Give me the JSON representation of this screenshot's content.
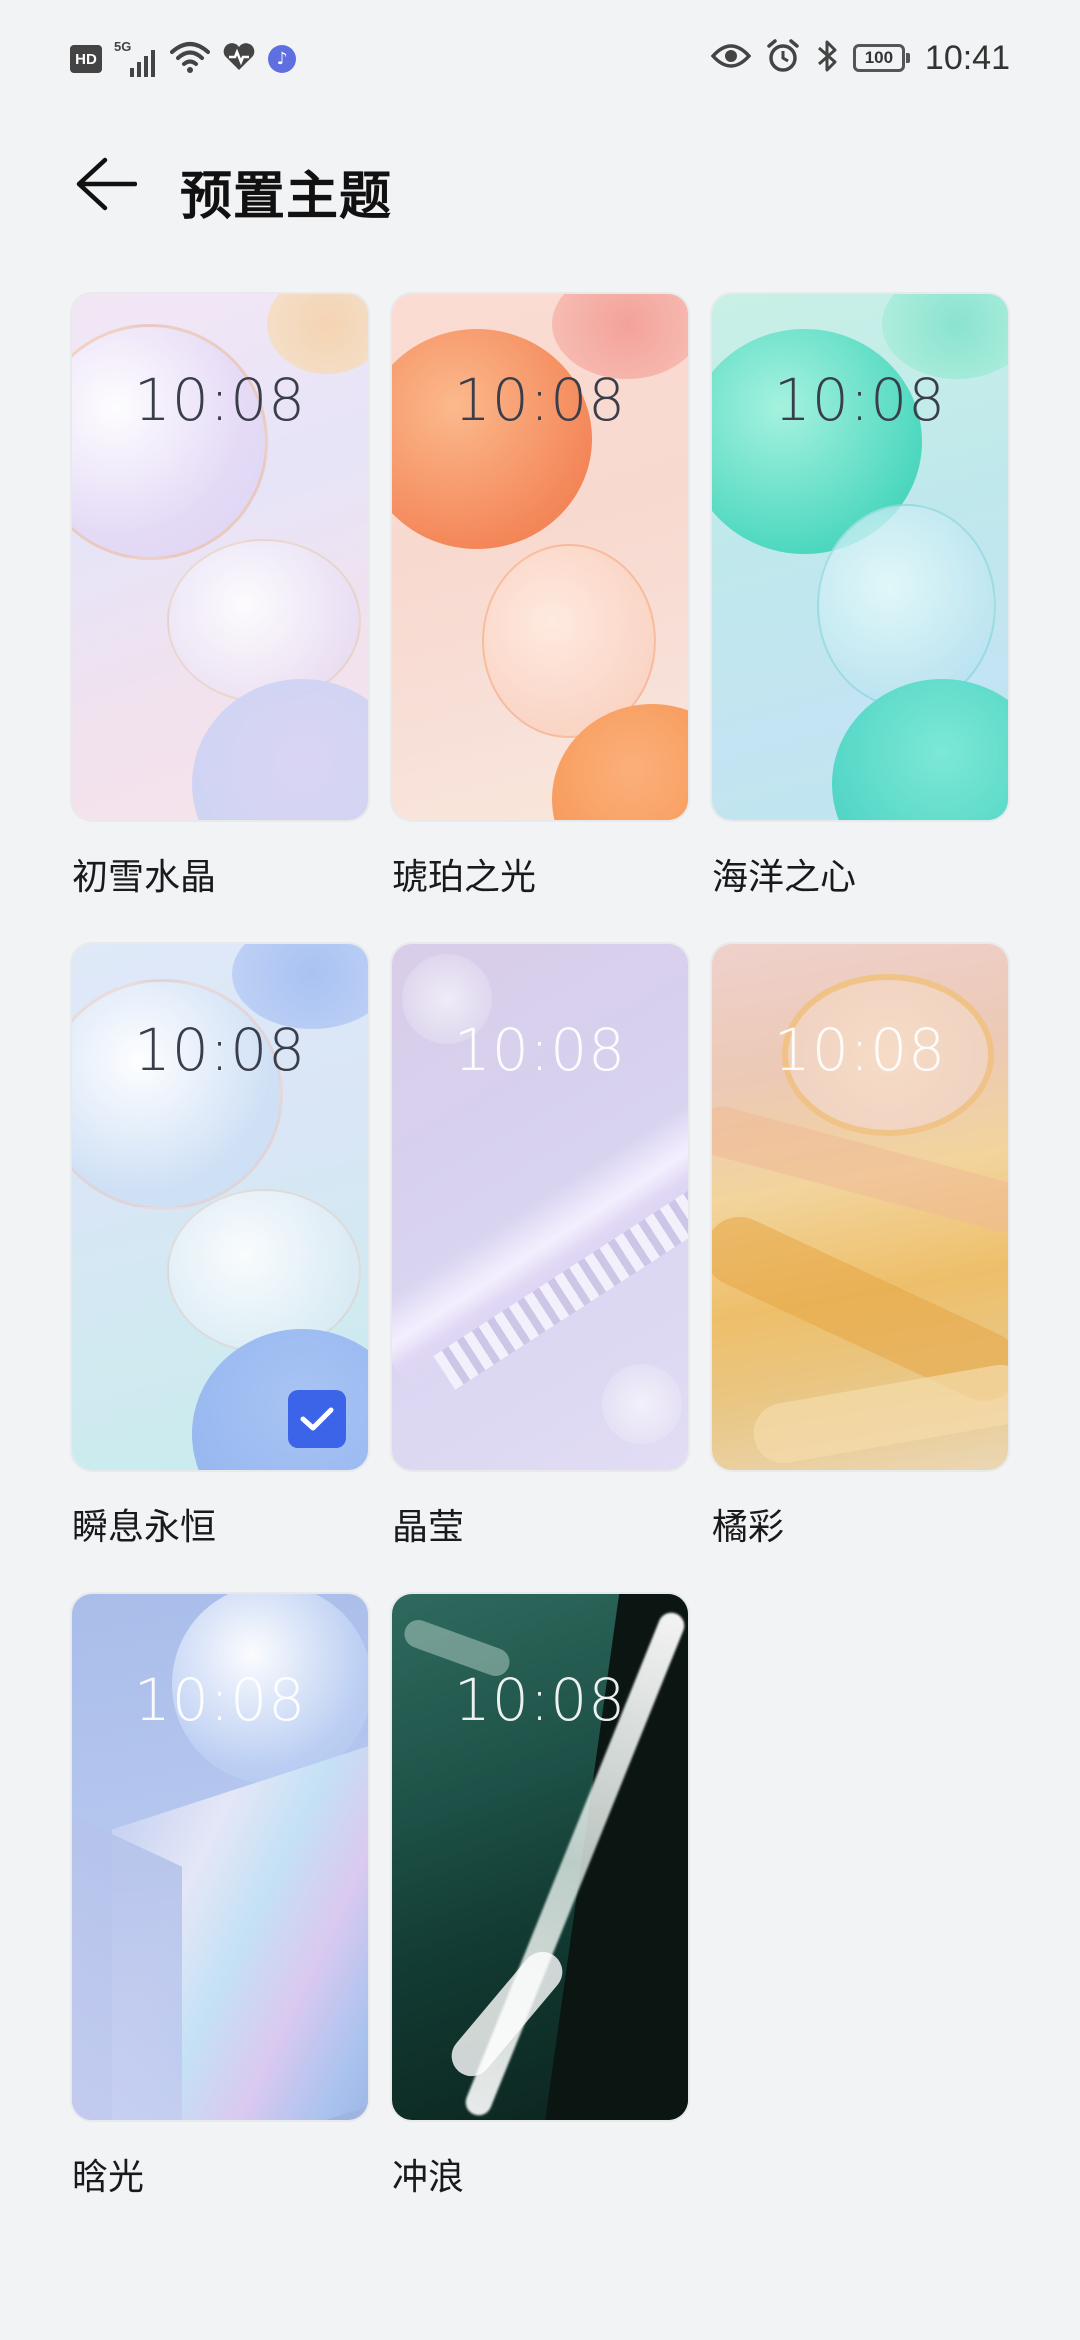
{
  "status_bar": {
    "hd_label": "HD",
    "network_label": "5G",
    "battery_level": "100",
    "time": "10:41",
    "icons": [
      "hd-icon",
      "cell-signal-icon",
      "wifi-icon",
      "health-heart-icon",
      "music-icon",
      "eye-comfort-icon",
      "alarm-icon",
      "bluetooth-icon",
      "battery-icon"
    ]
  },
  "header": {
    "back_icon": "arrow-left-icon",
    "title": "预置主题"
  },
  "themes": [
    {
      "name": "初雪水晶",
      "time": "10:08",
      "selected": false
    },
    {
      "name": "琥珀之光",
      "time": "10:08",
      "selected": false
    },
    {
      "name": "海洋之心",
      "time": "10:08",
      "selected": false
    },
    {
      "name": "瞬息永恒",
      "time": "10:08",
      "selected": true
    },
    {
      "name": "晶莹",
      "time": "10:08",
      "selected": false
    },
    {
      "name": "橘彩",
      "time": "10:08",
      "selected": false
    },
    {
      "name": "晗光",
      "time": "10:08",
      "selected": false
    },
    {
      "name": "冲浪",
      "time": "10:08",
      "selected": false
    }
  ],
  "colors": {
    "background": "#f1f3f5",
    "accent": "#3b64e8"
  }
}
